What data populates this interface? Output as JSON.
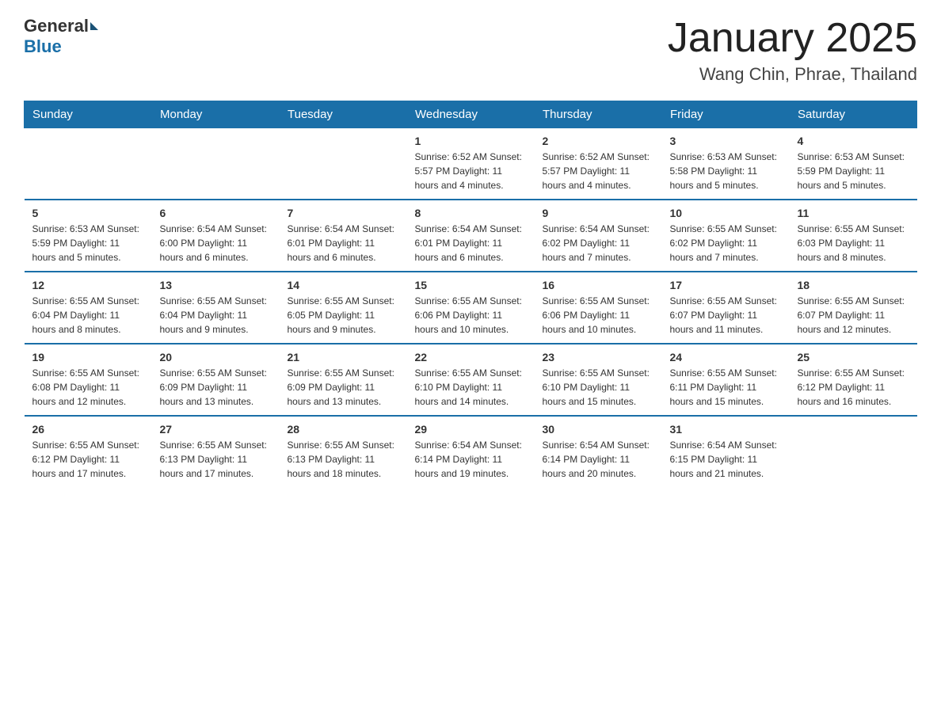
{
  "header": {
    "logo_general": "General",
    "logo_blue": "Blue",
    "month_title": "January 2025",
    "location": "Wang Chin, Phrae, Thailand"
  },
  "weekdays": [
    "Sunday",
    "Monday",
    "Tuesday",
    "Wednesday",
    "Thursday",
    "Friday",
    "Saturday"
  ],
  "weeks": [
    [
      {
        "day": "",
        "info": ""
      },
      {
        "day": "",
        "info": ""
      },
      {
        "day": "",
        "info": ""
      },
      {
        "day": "1",
        "info": "Sunrise: 6:52 AM\nSunset: 5:57 PM\nDaylight: 11 hours and 4 minutes."
      },
      {
        "day": "2",
        "info": "Sunrise: 6:52 AM\nSunset: 5:57 PM\nDaylight: 11 hours and 4 minutes."
      },
      {
        "day": "3",
        "info": "Sunrise: 6:53 AM\nSunset: 5:58 PM\nDaylight: 11 hours and 5 minutes."
      },
      {
        "day": "4",
        "info": "Sunrise: 6:53 AM\nSunset: 5:59 PM\nDaylight: 11 hours and 5 minutes."
      }
    ],
    [
      {
        "day": "5",
        "info": "Sunrise: 6:53 AM\nSunset: 5:59 PM\nDaylight: 11 hours and 5 minutes."
      },
      {
        "day": "6",
        "info": "Sunrise: 6:54 AM\nSunset: 6:00 PM\nDaylight: 11 hours and 6 minutes."
      },
      {
        "day": "7",
        "info": "Sunrise: 6:54 AM\nSunset: 6:01 PM\nDaylight: 11 hours and 6 minutes."
      },
      {
        "day": "8",
        "info": "Sunrise: 6:54 AM\nSunset: 6:01 PM\nDaylight: 11 hours and 6 minutes."
      },
      {
        "day": "9",
        "info": "Sunrise: 6:54 AM\nSunset: 6:02 PM\nDaylight: 11 hours and 7 minutes."
      },
      {
        "day": "10",
        "info": "Sunrise: 6:55 AM\nSunset: 6:02 PM\nDaylight: 11 hours and 7 minutes."
      },
      {
        "day": "11",
        "info": "Sunrise: 6:55 AM\nSunset: 6:03 PM\nDaylight: 11 hours and 8 minutes."
      }
    ],
    [
      {
        "day": "12",
        "info": "Sunrise: 6:55 AM\nSunset: 6:04 PM\nDaylight: 11 hours and 8 minutes."
      },
      {
        "day": "13",
        "info": "Sunrise: 6:55 AM\nSunset: 6:04 PM\nDaylight: 11 hours and 9 minutes."
      },
      {
        "day": "14",
        "info": "Sunrise: 6:55 AM\nSunset: 6:05 PM\nDaylight: 11 hours and 9 minutes."
      },
      {
        "day": "15",
        "info": "Sunrise: 6:55 AM\nSunset: 6:06 PM\nDaylight: 11 hours and 10 minutes."
      },
      {
        "day": "16",
        "info": "Sunrise: 6:55 AM\nSunset: 6:06 PM\nDaylight: 11 hours and 10 minutes."
      },
      {
        "day": "17",
        "info": "Sunrise: 6:55 AM\nSunset: 6:07 PM\nDaylight: 11 hours and 11 minutes."
      },
      {
        "day": "18",
        "info": "Sunrise: 6:55 AM\nSunset: 6:07 PM\nDaylight: 11 hours and 12 minutes."
      }
    ],
    [
      {
        "day": "19",
        "info": "Sunrise: 6:55 AM\nSunset: 6:08 PM\nDaylight: 11 hours and 12 minutes."
      },
      {
        "day": "20",
        "info": "Sunrise: 6:55 AM\nSunset: 6:09 PM\nDaylight: 11 hours and 13 minutes."
      },
      {
        "day": "21",
        "info": "Sunrise: 6:55 AM\nSunset: 6:09 PM\nDaylight: 11 hours and 13 minutes."
      },
      {
        "day": "22",
        "info": "Sunrise: 6:55 AM\nSunset: 6:10 PM\nDaylight: 11 hours and 14 minutes."
      },
      {
        "day": "23",
        "info": "Sunrise: 6:55 AM\nSunset: 6:10 PM\nDaylight: 11 hours and 15 minutes."
      },
      {
        "day": "24",
        "info": "Sunrise: 6:55 AM\nSunset: 6:11 PM\nDaylight: 11 hours and 15 minutes."
      },
      {
        "day": "25",
        "info": "Sunrise: 6:55 AM\nSunset: 6:12 PM\nDaylight: 11 hours and 16 minutes."
      }
    ],
    [
      {
        "day": "26",
        "info": "Sunrise: 6:55 AM\nSunset: 6:12 PM\nDaylight: 11 hours and 17 minutes."
      },
      {
        "day": "27",
        "info": "Sunrise: 6:55 AM\nSunset: 6:13 PM\nDaylight: 11 hours and 17 minutes."
      },
      {
        "day": "28",
        "info": "Sunrise: 6:55 AM\nSunset: 6:13 PM\nDaylight: 11 hours and 18 minutes."
      },
      {
        "day": "29",
        "info": "Sunrise: 6:54 AM\nSunset: 6:14 PM\nDaylight: 11 hours and 19 minutes."
      },
      {
        "day": "30",
        "info": "Sunrise: 6:54 AM\nSunset: 6:14 PM\nDaylight: 11 hours and 20 minutes."
      },
      {
        "day": "31",
        "info": "Sunrise: 6:54 AM\nSunset: 6:15 PM\nDaylight: 11 hours and 21 minutes."
      },
      {
        "day": "",
        "info": ""
      }
    ]
  ]
}
